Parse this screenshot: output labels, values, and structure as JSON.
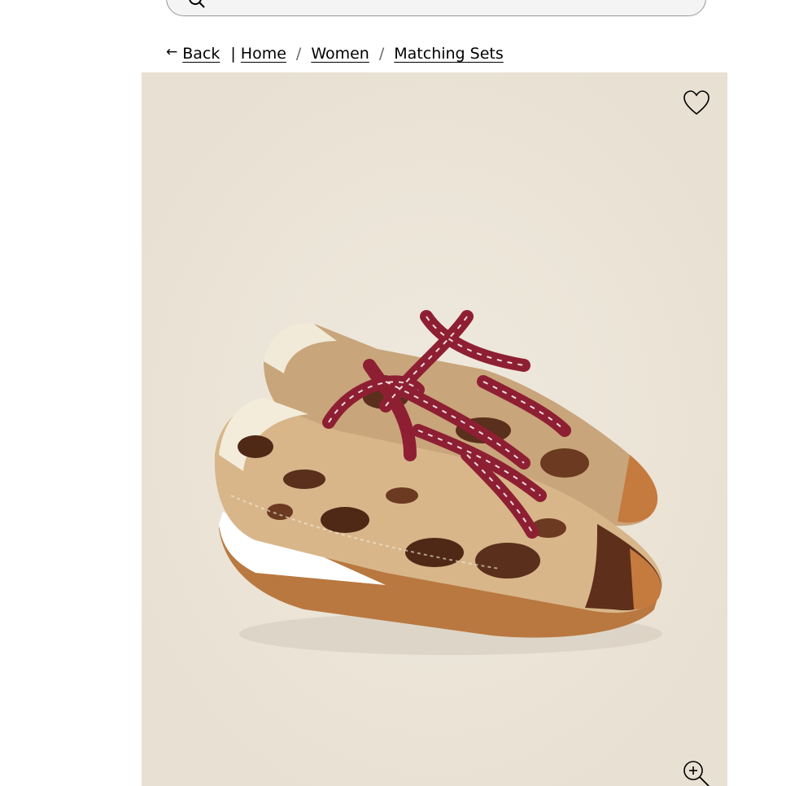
{
  "search": {
    "icon": "search-icon"
  },
  "breadcrumb": {
    "back_arrow": "←",
    "back_label": "Back",
    "separator_pipe": "|",
    "items": [
      {
        "label": "Home"
      },
      {
        "label": "Women"
      },
      {
        "label": "Matching Sets"
      }
    ],
    "separator": "/"
  },
  "product_image": {
    "subject": "sneakers",
    "background_color": "#ebe4d7",
    "wishlist_icon": "heart-outline-icon",
    "zoom_icon": "zoom-in-icon"
  }
}
